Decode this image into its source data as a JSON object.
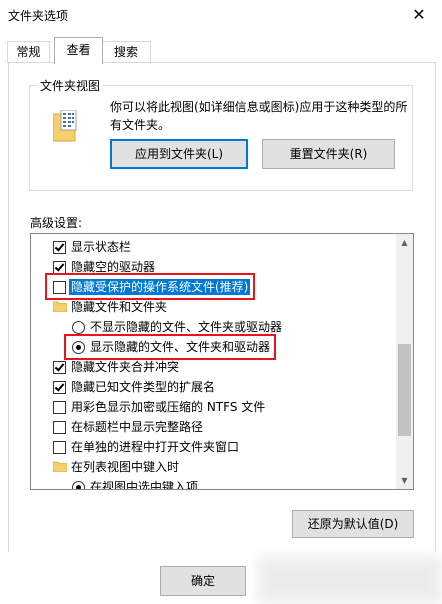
{
  "window": {
    "title": "文件夹选项"
  },
  "tabs": [
    {
      "label": "常规",
      "active": false
    },
    {
      "label": "查看",
      "active": true
    },
    {
      "label": "搜索",
      "active": false
    }
  ],
  "folder_views": {
    "legend": "文件夹视图",
    "description": "你可以将此视图(如详细信息或图标)应用于这种类型的所有文件夹。",
    "apply_button": "应用到文件夹(L)",
    "reset_button": "重置文件夹(R)"
  },
  "advanced": {
    "label": "高级设置:",
    "items": [
      {
        "kind": "checkbox",
        "label": "显示状态栏",
        "checked": true,
        "level": 1
      },
      {
        "kind": "checkbox",
        "label": "隐藏空的驱动器",
        "checked": true,
        "level": 1
      },
      {
        "kind": "checkbox",
        "label": "隐藏受保护的操作系统文件(推荐)",
        "checked": false,
        "level": 1,
        "selected": true
      },
      {
        "kind": "folder",
        "label": "隐藏文件和文件夹",
        "level": 1
      },
      {
        "kind": "radio",
        "label": "不显示隐藏的文件、文件夹或驱动器",
        "checked": false,
        "level": 2
      },
      {
        "kind": "radio",
        "label": "显示隐藏的文件、文件夹和驱动器",
        "checked": true,
        "level": 2
      },
      {
        "kind": "checkbox",
        "label": "隐藏文件夹合并冲突",
        "checked": true,
        "level": 1
      },
      {
        "kind": "checkbox",
        "label": "隐藏已知文件类型的扩展名",
        "checked": true,
        "level": 1
      },
      {
        "kind": "checkbox",
        "label": "用彩色显示加密或压缩的 NTFS 文件",
        "checked": false,
        "level": 1
      },
      {
        "kind": "checkbox",
        "label": "在标题栏中显示完整路径",
        "checked": false,
        "level": 1
      },
      {
        "kind": "checkbox",
        "label": "在单独的进程中打开文件夹窗口",
        "checked": false,
        "level": 1
      },
      {
        "kind": "folder",
        "label": "在列表视图中键入时",
        "level": 1
      },
      {
        "kind": "radio",
        "label": "在视图中选中键入项",
        "checked": true,
        "level": 2
      }
    ],
    "restore_defaults_button": "还原为默认值(D)"
  },
  "footer": {
    "ok_button": "确定"
  },
  "colors": {
    "highlight_box": "#e8141e",
    "selection": "#0078d7"
  }
}
